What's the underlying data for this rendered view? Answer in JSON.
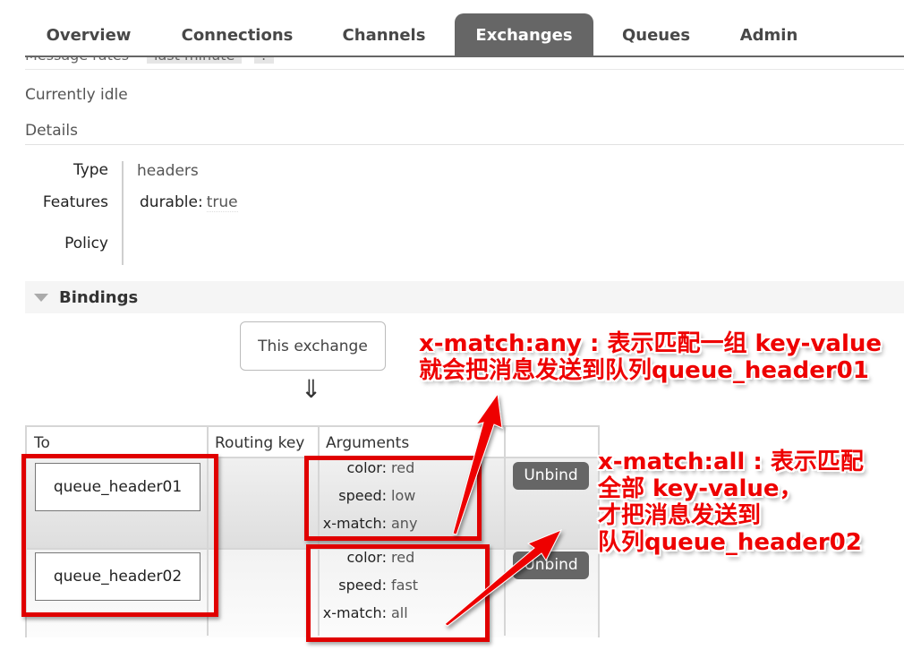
{
  "nav": {
    "tabs": [
      {
        "label": "Overview",
        "active": false
      },
      {
        "label": "Connections",
        "active": false
      },
      {
        "label": "Channels",
        "active": false
      },
      {
        "label": "Exchanges",
        "active": true
      },
      {
        "label": "Queues",
        "active": false
      },
      {
        "label": "Admin",
        "active": false
      }
    ]
  },
  "message_rates": {
    "label": "Message rates",
    "selected": "last minute",
    "help": "?"
  },
  "status": "Currently idle",
  "details": {
    "heading": "Details",
    "rows": [
      {
        "label": "Type",
        "value": "headers"
      },
      {
        "label": "Features",
        "key": "durable:",
        "value": "true"
      },
      {
        "label": "Policy",
        "value": ""
      }
    ]
  },
  "bindings": {
    "heading": "Bindings",
    "source_label": "This exchange",
    "arrow": "⇓",
    "columns": [
      "To",
      "Routing key",
      "Arguments",
      ""
    ],
    "rows": [
      {
        "to": "queue_header01",
        "routing_key": "",
        "arguments": [
          {
            "key": "color:",
            "value": "red"
          },
          {
            "key": "speed:",
            "value": "low"
          },
          {
            "key": "x-match:",
            "value": "any"
          }
        ],
        "action": "Unbind"
      },
      {
        "to": "queue_header02",
        "routing_key": "",
        "arguments": [
          {
            "key": "color:",
            "value": "red"
          },
          {
            "key": "speed:",
            "value": "fast"
          },
          {
            "key": "x-match:",
            "value": "all"
          }
        ],
        "action": "Unbind"
      }
    ]
  },
  "annotations": {
    "any": [
      "x-match:any : 表示匹配一组 key-value",
      "就会把消息发送到队列queue_header01"
    ],
    "all": [
      "x-match:all : 表示匹配",
      "全部 key-value，",
      "才把消息发送到",
      "队列queue_header02"
    ],
    "color": "#ee0000"
  }
}
